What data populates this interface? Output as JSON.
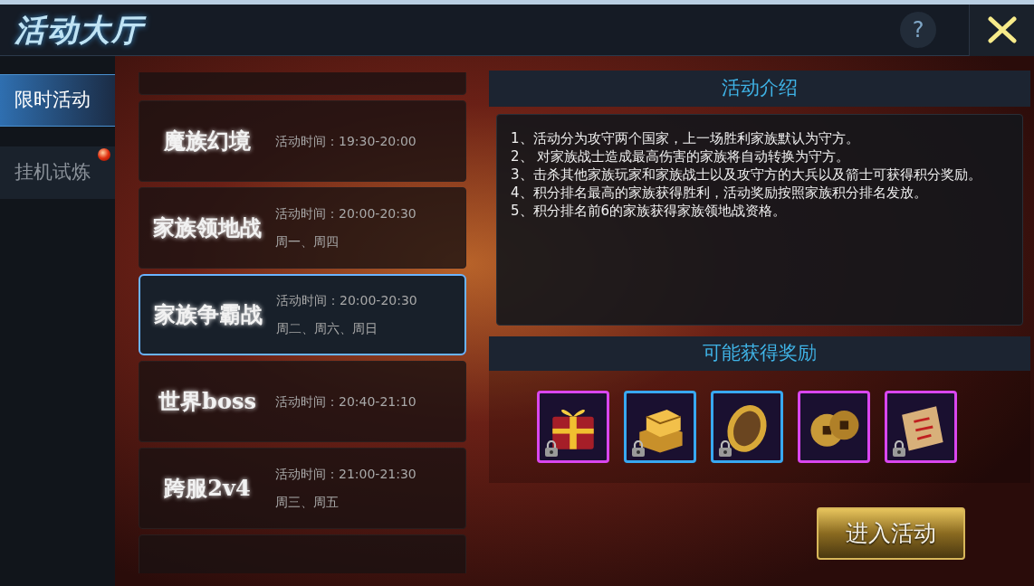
{
  "window": {
    "title": "活动大厅",
    "help_button": "?"
  },
  "sidebar": {
    "tabs": [
      {
        "label": "限时活动",
        "selected": true,
        "badge": false
      },
      {
        "label": "挂机试炼",
        "selected": false,
        "badge": true
      }
    ]
  },
  "activities": [
    {
      "name": "魔族幻境",
      "time": "活动时间：19:30-20:00",
      "selected": false
    },
    {
      "name": "家族领地战",
      "time": "活动时间：20:00-20:30",
      "days": "周一、周四",
      "selected": false
    },
    {
      "name": "家族争霸战",
      "time": "活动时间：20:00-20:30",
      "days": "周二、周六、周日",
      "selected": true
    },
    {
      "name": "世界boss",
      "time": "活动时间：20:40-21:10",
      "selected": false
    },
    {
      "name": "跨服2v4",
      "time": "活动时间：21:00-21:30",
      "days": "周三、周五",
      "selected": false
    }
  ],
  "intro": {
    "heading": "活动介绍",
    "lines": [
      "1、活动分为攻守两个国家，上一场胜利家族默认为守方。",
      "2、 对家族战士造成最高伤害的家族将自动转换为守方。",
      "3、击杀其他家族玩家和家族战士以及攻守方的大兵以及箭士可获得积分奖励。",
      "4、积分排名最高的家族获得胜利，活动奖励按照家族积分排名发放。",
      "5、积分排名前6的家族获得家族领地战资格。"
    ]
  },
  "rewards": {
    "heading": "可能获得奖励",
    "items": [
      {
        "kind": "gift",
        "color": "#d946ef",
        "locked": true
      },
      {
        "kind": "gold",
        "color": "#38a8f0",
        "locked": true
      },
      {
        "kind": "token",
        "color": "#38a8f0",
        "locked": true
      },
      {
        "kind": "coins",
        "color": "#d946ef",
        "locked": false
      },
      {
        "kind": "scroll",
        "color": "#d946ef",
        "locked": true
      }
    ]
  },
  "enter_button": "进入活动"
}
